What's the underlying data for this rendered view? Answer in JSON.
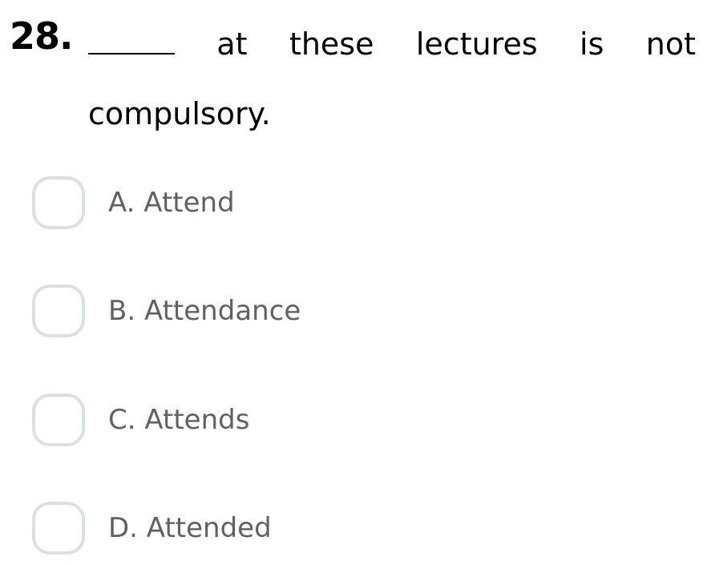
{
  "question": {
    "number": "28.",
    "blank": "",
    "words_line1": [
      "at",
      "these",
      "lectures",
      "is",
      "not"
    ],
    "line2": "compulsory."
  },
  "options": [
    {
      "letter": "A",
      "label": "A. Attend"
    },
    {
      "letter": "B",
      "label": "B. Attendance"
    },
    {
      "letter": "C",
      "label": "C. Attends"
    },
    {
      "letter": "D",
      "label": "D. Attended"
    }
  ],
  "colors": {
    "checkbox_border": "#dcdfe3",
    "option_text": "#5f6166",
    "question_text": "#000000"
  }
}
